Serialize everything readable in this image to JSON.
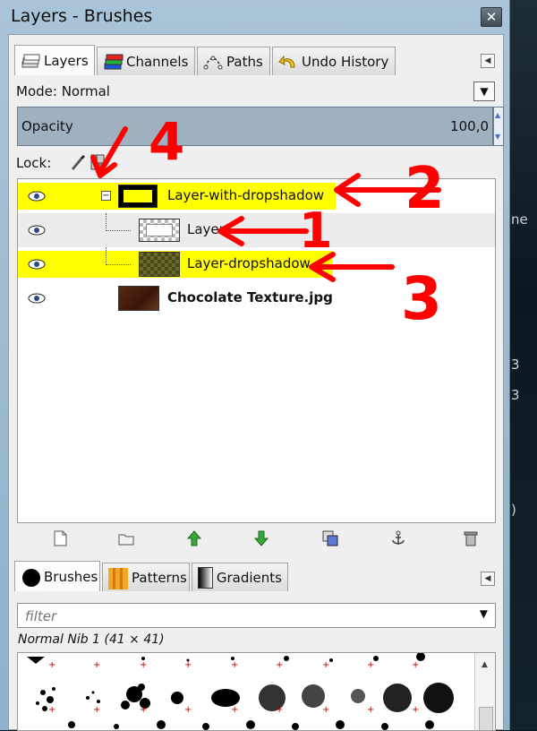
{
  "window": {
    "title": "Layers - Brushes",
    "close_glyph": "✕"
  },
  "dock_tabs": [
    {
      "label": "Layers",
      "icon": "layers-icon"
    },
    {
      "label": "Channels",
      "icon": "channels-icon"
    },
    {
      "label": "Paths",
      "icon": "paths-icon"
    },
    {
      "label": "Undo History",
      "icon": "undo-history-icon"
    }
  ],
  "mode": {
    "label": "Mode: Normal"
  },
  "opacity": {
    "label": "Opacity",
    "value": "100,0"
  },
  "lock": {
    "label": "Lock:"
  },
  "layers": [
    {
      "name": "Layer-with-dropshadow",
      "visible": true,
      "group": true,
      "highlighted": true
    },
    {
      "name": "Layer",
      "visible": true,
      "child": true,
      "highlighted": false
    },
    {
      "name": "Layer-dropshadow",
      "visible": true,
      "child": true,
      "highlighted": true
    },
    {
      "name": "Chocolate Texture.jpg",
      "visible": true,
      "bold": true,
      "highlighted": false
    }
  ],
  "layer_buttons": [
    "new-layer-icon",
    "new-group-icon",
    "raise-layer-icon",
    "lower-layer-icon",
    "duplicate-layer-icon",
    "anchor-layer-icon",
    "delete-layer-icon"
  ],
  "brush_tabs": [
    {
      "label": "Brushes",
      "icon": "brush-icon"
    },
    {
      "label": "Patterns",
      "icon": "pattern-icon"
    },
    {
      "label": "Gradients",
      "icon": "gradient-icon"
    }
  ],
  "filter": {
    "placeholder": "filter"
  },
  "brush": {
    "name": "Normal Nib 1 (41 × 41)"
  },
  "annotations": [
    "1",
    "2",
    "3",
    "4"
  ],
  "desktop_fragments": [
    "ne",
    "3",
    "3",
    ")"
  ],
  "colors": {
    "highlight": "#ffff00",
    "annotation": "#ff0000",
    "opacity_bar": "#9fb0bf"
  }
}
